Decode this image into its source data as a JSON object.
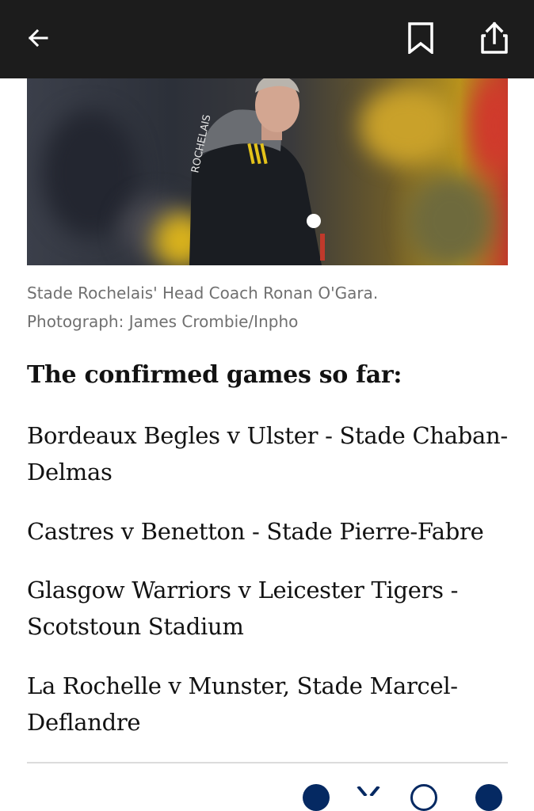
{
  "topbar": {
    "back_icon": "arrow-left-icon",
    "bookmark_icon": "bookmark-icon",
    "share_icon": "share-icon"
  },
  "photo": {
    "alt": "Stade Rochelais' Head Coach Ronan O'Gara"
  },
  "caption": {
    "line1": "Stade Rochelais' Head Coach Ronan O'Gara.",
    "line2": "Photograph: James Crombie/Inpho"
  },
  "article": {
    "subhead": "The confirmed games so far:",
    "fixtures": [
      "Bordeaux Begles v Ulster - Stade Chaban-Delmas",
      "Castres v Benetton - Stade Pierre-Fabre",
      "Glasgow Warriors v Leicester Tigers - Scotstoun Stadium",
      "La Rochelle v Munster, Stade Marcel-Deflandre"
    ]
  },
  "share_bar": {
    "icons": [
      "email-icon",
      "x-icon",
      "whatsapp-icon",
      "facebook-icon"
    ]
  },
  "colors": {
    "topbar": "#1c1c1c",
    "text": "#121212",
    "caption": "#707070",
    "share_icon": "#052962"
  }
}
